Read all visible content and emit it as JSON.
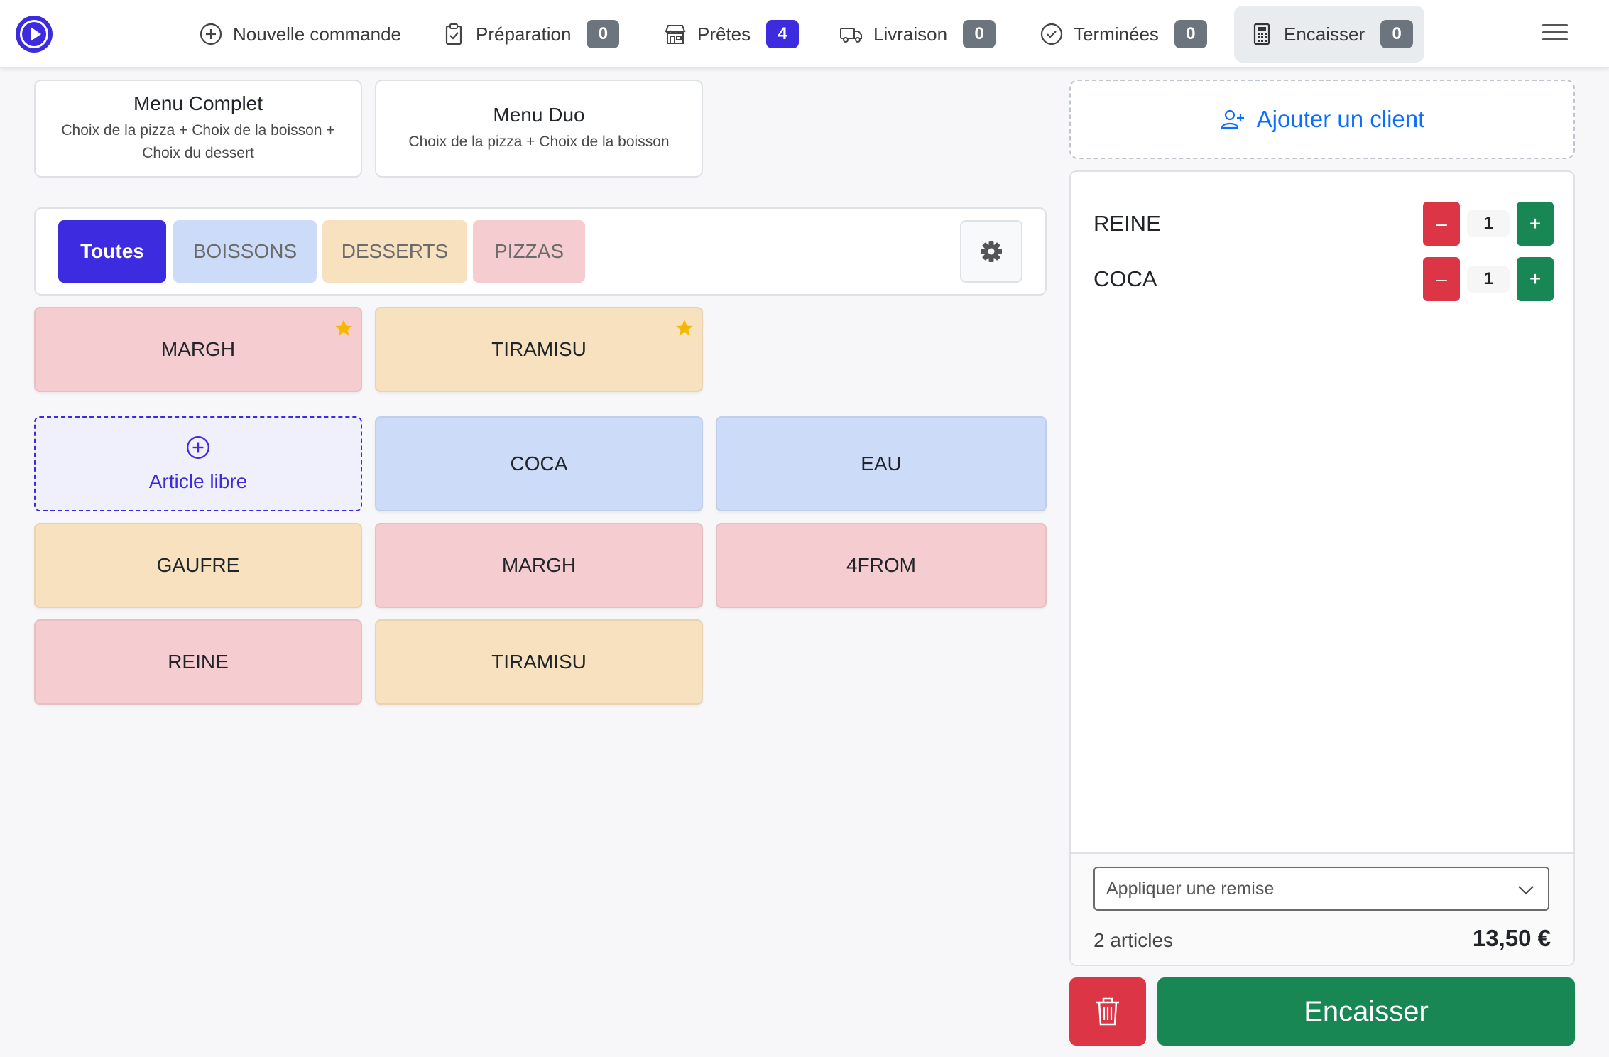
{
  "nav": {
    "new_order": "Nouvelle commande",
    "preparation": {
      "label": "Préparation",
      "count": "0"
    },
    "ready": {
      "label": "Prêtes",
      "count": "4"
    },
    "delivery": {
      "label": "Livraison",
      "count": "0"
    },
    "done": {
      "label": "Terminées",
      "count": "0"
    },
    "cashout": {
      "label": "Encaisser",
      "count": "0"
    }
  },
  "menus": [
    {
      "title": "Menu Complet",
      "desc": "Choix de la pizza + Choix de la boisson + Choix du dessert"
    },
    {
      "title": "Menu Duo",
      "desc": "Choix de la pizza + Choix de la boisson"
    }
  ],
  "categories": [
    "Toutes",
    "BOISSONS",
    "DESSERTS",
    "PIZZAS"
  ],
  "favorites": [
    "MARGH",
    "TIRAMISU"
  ],
  "free_article": "Article libre",
  "products": [
    "COCA",
    "EAU",
    "GAUFRE",
    "MARGH",
    "4FROM",
    "REINE",
    "TIRAMISU"
  ],
  "add_client": "Ajouter un client",
  "cart": {
    "lines": [
      {
        "name": "REINE",
        "qty": "1"
      },
      {
        "name": "COCA",
        "qty": "1"
      }
    ],
    "minus": "–",
    "plus": "+",
    "discount_placeholder": "Appliquer une remise",
    "count": "2 articles",
    "total": "13,50 €"
  },
  "pay_label": "Encaisser",
  "colors": {
    "accent": "#3d2be0",
    "pizza": "#f5cccf",
    "dessert": "#f7e1bf",
    "drink": "#ccdcf8",
    "danger": "#dc3545",
    "success": "#198754",
    "link": "#0d6efd"
  }
}
